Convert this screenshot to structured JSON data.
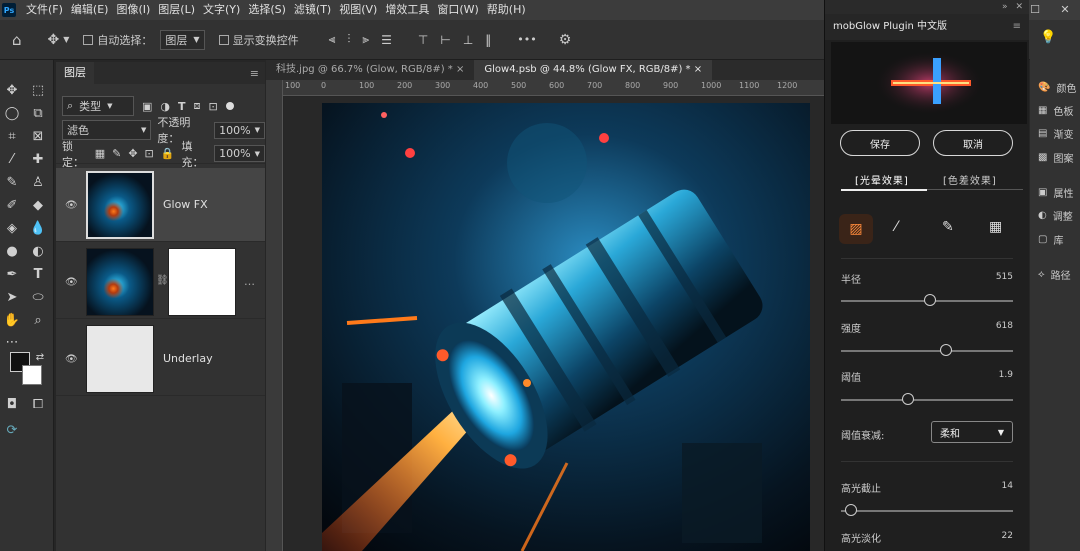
{
  "app": {
    "logo": "Ps"
  },
  "menu": [
    "文件(F)",
    "编辑(E)",
    "图像(I)",
    "图层(L)",
    "文字(Y)",
    "选择(S)",
    "滤镜(T)",
    "视图(V)",
    "增效工具",
    "窗口(W)",
    "帮助(H)"
  ],
  "window_controls": {
    "minimize": "—",
    "maximize": "☐",
    "close": "✕"
  },
  "options_bar": {
    "auto_select_label": "自动选择：",
    "auto_select_value": "图层",
    "show_transform_label": "显示变换控件",
    "more": "•••"
  },
  "layers_panel": {
    "tab": "图层",
    "filter_value": "类型",
    "blend_mode": "滤色",
    "opacity_label": "不透明度：",
    "opacity_value": "100%",
    "lock_label": "锁定：",
    "fill_label": "填充：",
    "fill_value": "100%",
    "layers": [
      {
        "name": "Glow FX"
      },
      {
        "name": ""
      },
      {
        "name": "Underlay"
      }
    ]
  },
  "doc_tabs": [
    {
      "label": "科技.jpg @ 66.7% (Glow, RGB/8#) *",
      "close": "×"
    },
    {
      "label": "Glow4.psb @ 44.8% (Glow FX, RGB/8#) *",
      "close": "×"
    }
  ],
  "ruler_ticks": [
    "100",
    "0",
    "100",
    "200",
    "300",
    "400",
    "500",
    "600",
    "700",
    "800",
    "900",
    "1000",
    "1100",
    "1200"
  ],
  "plugin": {
    "title": "mobGlow Plugin 中文版",
    "save": "保存",
    "cancel": "取消",
    "tab_glow": "[光晕效果]",
    "tab_chroma": "[色差效果]",
    "sliders": [
      {
        "label": "半径",
        "value": "515",
        "fraction": 0.52
      },
      {
        "label": "强度",
        "value": "618",
        "fraction": 0.61
      },
      {
        "label": "阈值",
        "value": "1.9",
        "fraction": 0.39
      }
    ],
    "falloff_label": "阈值衰减:",
    "falloff_value": "柔和",
    "highlight_cut_label": "高光截止",
    "highlight_cut_value": "14",
    "highlight_cut_fraction": 0.06,
    "highlight_fade_label": "高光淡化",
    "highlight_fade_value": "22"
  },
  "right_rail": [
    {
      "label": "颜色",
      "icon": "palette-icon"
    },
    {
      "label": "色板",
      "icon": "swatches-icon"
    },
    {
      "label": "渐变",
      "icon": "gradient-icon"
    },
    {
      "label": "图案",
      "icon": "pattern-icon"
    },
    {
      "label": "属性",
      "icon": "properties-icon"
    },
    {
      "label": "调整",
      "icon": "adjustments-icon"
    },
    {
      "label": "库",
      "icon": "libraries-icon"
    },
    {
      "label": "路径",
      "icon": "paths-icon"
    }
  ],
  "colors": {
    "accent": "#31a8ff",
    "glow_orange": "#ff7a1a",
    "glow_cyan": "#39d3ff",
    "panel": "#323232"
  }
}
